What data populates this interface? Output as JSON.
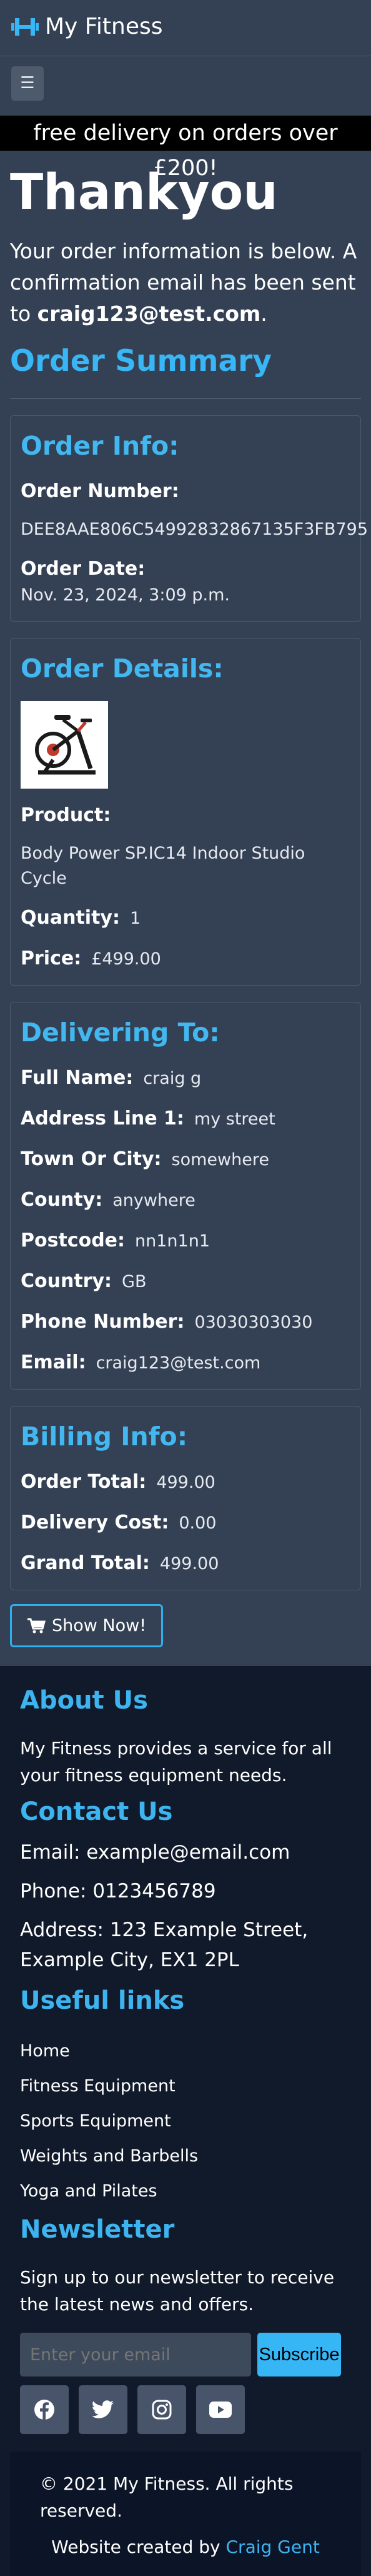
{
  "header": {
    "brand": "My Fitness",
    "menu_icon": "hamburger-icon",
    "brand_icon": "dumbbell-icon"
  },
  "banner": {
    "text": "free delivery on orders over £200!"
  },
  "page": {
    "title": "Thankyou",
    "intro_text": "Your order information is below. A confirmation email has been sent to",
    "intro_email": "craig123@test.com",
    "summary_heading": "Order Summary"
  },
  "order_info": {
    "heading": "Order Info:",
    "number_label": "Order Number:",
    "number_value": "DEE8AAE806C54992832867135F3FB795",
    "date_label": "Order Date:",
    "date_value": "Nov. 23, 2024, 3:09 p.m."
  },
  "order_details": {
    "heading": "Order Details:",
    "product_label": "Product:",
    "product_value": "Body Power SP.IC14 Indoor Studio Cycle",
    "quantity_label": "Quantity:",
    "quantity_value": "1",
    "price_label": "Price:",
    "price_value": "£499.00"
  },
  "delivering": {
    "heading": "Delivering To:",
    "fields": [
      {
        "label": "Full Name:",
        "value": "craig g"
      },
      {
        "label": "Address Line 1:",
        "value": "my street"
      },
      {
        "label": "Town Or City:",
        "value": "somewhere"
      },
      {
        "label": "County:",
        "value": "anywhere"
      },
      {
        "label": "Postcode:",
        "value": "nn1n1n1"
      },
      {
        "label": "Country:",
        "value": "GB"
      },
      {
        "label": "Phone Number:",
        "value": "03030303030"
      },
      {
        "label": "Email:",
        "value": "craig123@test.com"
      }
    ]
  },
  "billing": {
    "heading": "Billing Info:",
    "total_label": "Order Total:",
    "total_value": "499.00",
    "delivery_label": "Delivery Cost:",
    "delivery_value": "0.00",
    "grand_label": "Grand Total:",
    "grand_value": "499.00"
  },
  "actions": {
    "show_now": "Show Now!"
  },
  "footer": {
    "about_heading": "About Us",
    "about_text": "My Fitness provides a service for all your fitness equipment needs.",
    "contact_heading": "Contact Us",
    "email": "Email: example@email.com",
    "phone": "Phone: 0123456789",
    "address": "Address: 123 Example Street, Example City, EX1 2PL",
    "links_heading": "Useful links",
    "links": [
      "Home",
      "Fitness Equipment",
      "Sports Equipment",
      "Weights and Barbells",
      "Yoga and Pilates"
    ],
    "newsletter_heading": "Newsletter",
    "newsletter_text": "Sign up to our newsletter to receive the latest news and offers.",
    "email_placeholder": "Enter your email",
    "subscribe": "Subscribe",
    "social_icons": [
      "facebook-icon",
      "twitter-icon",
      "instagram-icon",
      "youtube-icon"
    ],
    "copyright": "© 2021 My Fitness. All rights reserved.",
    "credit_prefix": "Website created by",
    "credit_name": "Craig Gent"
  },
  "colors": {
    "accent": "#38b6f5",
    "page_bg": "#344154",
    "footer_bg": "#111a2a",
    "banner_bg": "#000000"
  }
}
